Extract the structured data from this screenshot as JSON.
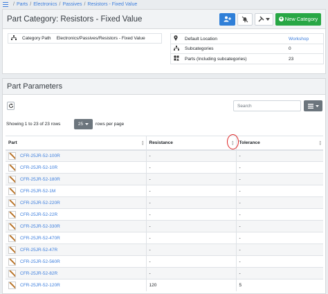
{
  "breadcrumb": [
    "Parts",
    "Electronics",
    "Passives",
    "Resistors - Fixed Value"
  ],
  "header": {
    "title": "Part Category: Resistors - Fixed Value",
    "new_category_label": "New Category"
  },
  "details": {
    "category_path_label": "Category Path",
    "category_path_value": "Electronics/Passives/Resistors - Fixed Value",
    "default_location_label": "Default Location",
    "default_location_value": "Workshop",
    "subcategories_label": "Subcategories",
    "subcategories_value": "0",
    "parts_label": "Parts (Including subcategories)",
    "parts_value": "23"
  },
  "params": {
    "title": "Part Parameters",
    "search_placeholder": "Search",
    "showing": "Showing 1 to 23 of 23 rows",
    "rows_per_page": "25",
    "rows_per_page_label": "rows per page",
    "columns": [
      "Part",
      "Resistance",
      "Tolerance"
    ],
    "rows": [
      {
        "part": "CFR-25JR-52-100R",
        "resistance": "-",
        "tolerance": "-"
      },
      {
        "part": "CFR-25JR-52-10R",
        "resistance": "-",
        "tolerance": "-"
      },
      {
        "part": "CFR-25JR-52-180R",
        "resistance": "-",
        "tolerance": "-"
      },
      {
        "part": "CFR-25JR-52-1M",
        "resistance": "-",
        "tolerance": "-"
      },
      {
        "part": "CFR-25JR-52-220R",
        "resistance": "-",
        "tolerance": "-"
      },
      {
        "part": "CFR-25JR-52-22R",
        "resistance": "-",
        "tolerance": "-"
      },
      {
        "part": "CFR-25JR-52-330R",
        "resistance": "-",
        "tolerance": "-"
      },
      {
        "part": "CFR-25JR-52-470R",
        "resistance": "-",
        "tolerance": "-"
      },
      {
        "part": "CFR-25JR-52-47R",
        "resistance": "-",
        "tolerance": "-"
      },
      {
        "part": "CFR-25JR-52-560R",
        "resistance": "-",
        "tolerance": "-"
      },
      {
        "part": "CFR-25JR-52-82R",
        "resistance": "-",
        "tolerance": "-"
      },
      {
        "part": "CFR-25JR-52-120R",
        "resistance": "120",
        "tolerance": "5"
      }
    ]
  },
  "icons": {
    "menu": "menu-icon",
    "subscribe": "user-plus-icon",
    "unsubscribe": "bell-slash-icon",
    "tools": "tools-icon",
    "refresh": "refresh-icon",
    "columns": "grid-icon",
    "sort": "sort-icon",
    "tree": "sitemap-icon",
    "location": "map-marker-icon",
    "parts": "shapes-icon"
  },
  "colors": {
    "primary": "#2f7fd8",
    "success": "#28a745",
    "secondary": "#6c757d",
    "link": "#3b7ddd",
    "annotation": "#dd2222"
  }
}
